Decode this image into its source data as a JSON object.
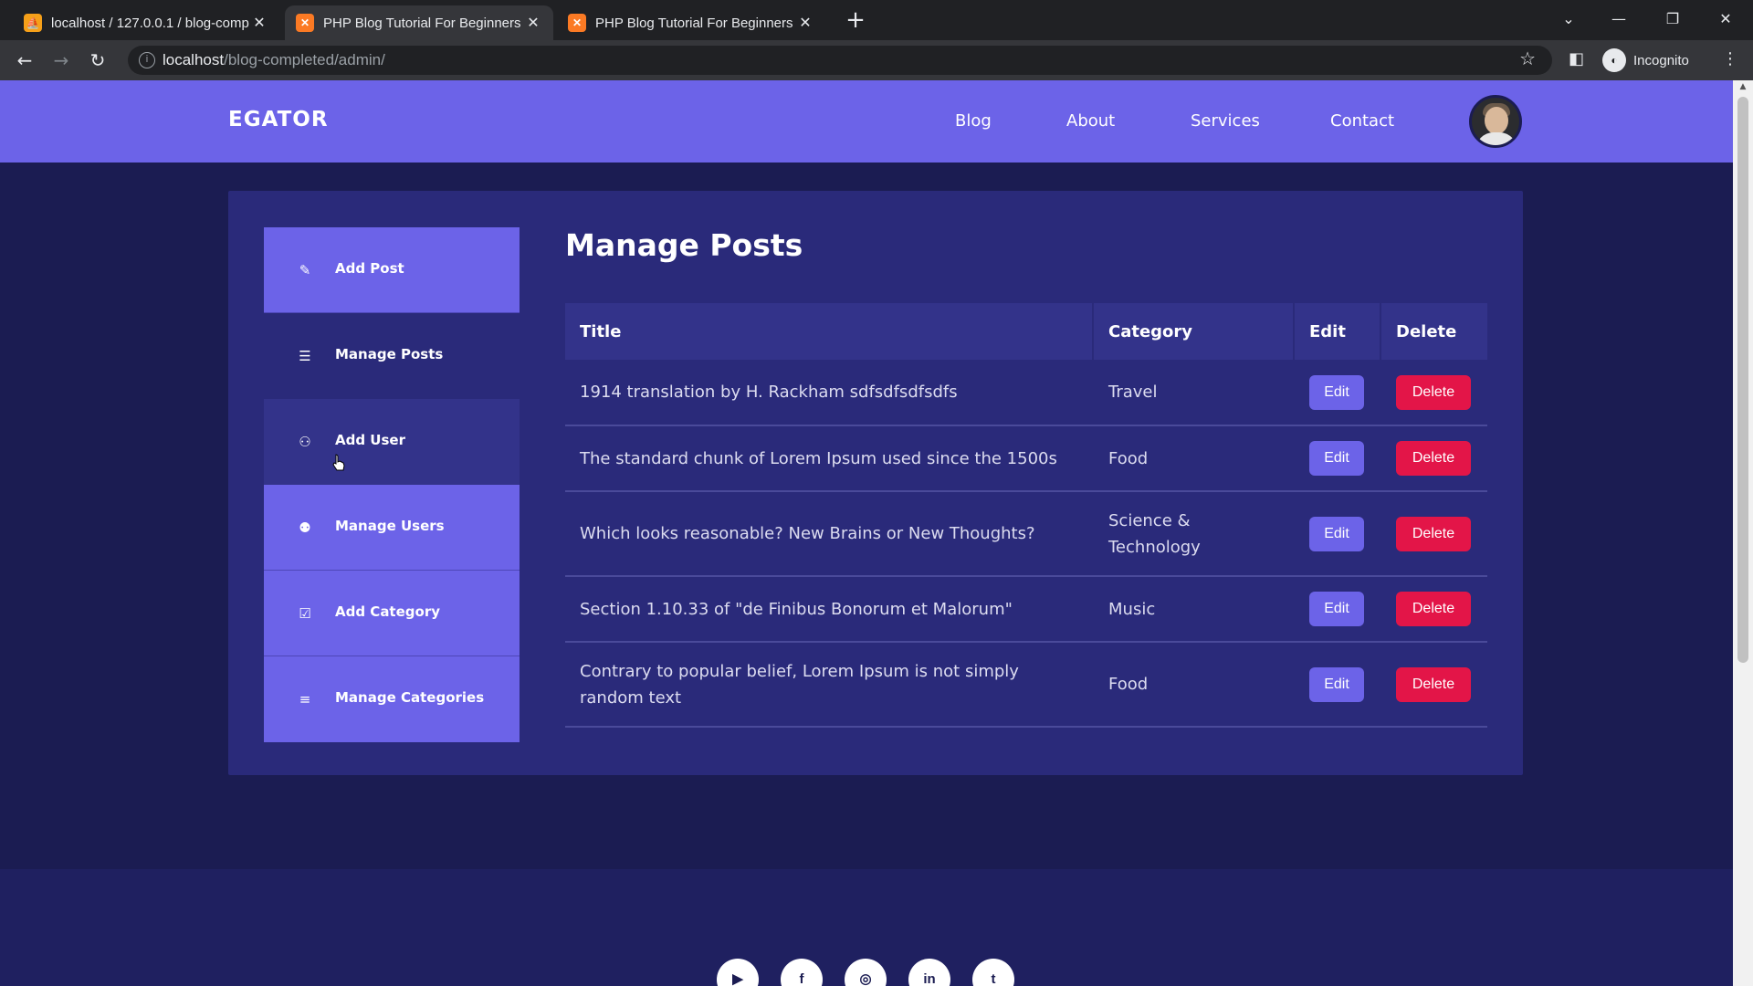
{
  "browser": {
    "tabs": [
      {
        "title": "localhost / 127.0.0.1 / blog-comp",
        "icon": "phpmyadmin-icon",
        "active": false
      },
      {
        "title": "PHP Blog Tutorial For Beginners",
        "icon": "xampp-icon",
        "active": true
      },
      {
        "title": "PHP Blog Tutorial For Beginners",
        "icon": "xampp-icon",
        "active": false
      }
    ],
    "url_host": "localhost",
    "url_path": "/blog-completed/admin/",
    "incognito_label": "Incognito"
  },
  "site": {
    "logo": "EGATOR",
    "nav": [
      "Blog",
      "About",
      "Services",
      "Contact"
    ],
    "accent_color": "#6c63e8",
    "danger_color": "#e31548",
    "background_color": "#1b1c52"
  },
  "sidebar": {
    "items": [
      {
        "label": "Add Post",
        "icon": "pencil-icon"
      },
      {
        "label": "Manage Posts",
        "icon": "posts-list-icon"
      },
      {
        "label": "Add User",
        "icon": "add-user-icon"
      },
      {
        "label": "Manage Users",
        "icon": "users-icon"
      },
      {
        "label": "Add Category",
        "icon": "edit-box-icon"
      },
      {
        "label": "Manage Categories",
        "icon": "list-icon"
      }
    ]
  },
  "main": {
    "title": "Manage Posts",
    "table": {
      "headers": [
        "Title",
        "Category",
        "Edit",
        "Delete"
      ],
      "rows": [
        {
          "title": "1914 translation by H. Rackham sdfsdfsdfsdfs",
          "category": "Travel",
          "edit": "Edit",
          "delete": "Delete"
        },
        {
          "title": "The standard chunk of Lorem Ipsum used since the 1500s",
          "category": "Food",
          "edit": "Edit",
          "delete": "Delete"
        },
        {
          "title": "Which looks reasonable? New Brains or New Thoughts?",
          "category": "Science & Technology",
          "edit": "Edit",
          "delete": "Delete"
        },
        {
          "title": "Section 1.10.33 of \"de Finibus Bonorum et Malorum\"",
          "category": "Music",
          "edit": "Edit",
          "delete": "Delete"
        },
        {
          "title": "Contrary to popular belief, Lorem Ipsum is not simply random text",
          "category": "Food",
          "edit": "Edit",
          "delete": "Delete"
        }
      ]
    }
  },
  "footer": {
    "social": [
      {
        "icon": "youtube-icon",
        "glyph": "▶"
      },
      {
        "icon": "facebook-icon",
        "glyph": "f"
      },
      {
        "icon": "instagram-icon",
        "glyph": "◎"
      },
      {
        "icon": "linkedin-icon",
        "glyph": "in"
      },
      {
        "icon": "twitter-icon",
        "glyph": "t"
      }
    ]
  }
}
